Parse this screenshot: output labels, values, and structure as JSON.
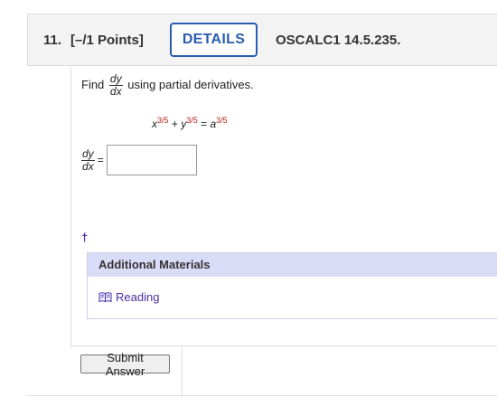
{
  "question": {
    "number": "11.",
    "points": "[–/1 Points]",
    "details_label": "DETAILS",
    "code": "OSCALC1 14.5.235."
  },
  "prompt": {
    "find": "Find",
    "frac_num": "dy",
    "frac_den": "dx",
    "rest": "using partial derivatives."
  },
  "equation": {
    "x": "x",
    "x_exp": "3/5",
    "plus": "+",
    "y": "y",
    "y_exp": "3/5",
    "equals": "=",
    "a": "a",
    "a_exp": "3/5"
  },
  "answer": {
    "frac_num": "dy",
    "frac_den": "dx",
    "equals": "=",
    "value": ""
  },
  "dagger": "†",
  "additional_materials": {
    "title": "Additional Materials",
    "link_label": "Reading",
    "link_icon": "book-icon"
  },
  "submit_label": "Submit Answer",
  "colors": {
    "accent": "#2a5db0",
    "link": "#4b2ea8",
    "exponent": "#b52020",
    "am_header": "#d9dcf7"
  }
}
